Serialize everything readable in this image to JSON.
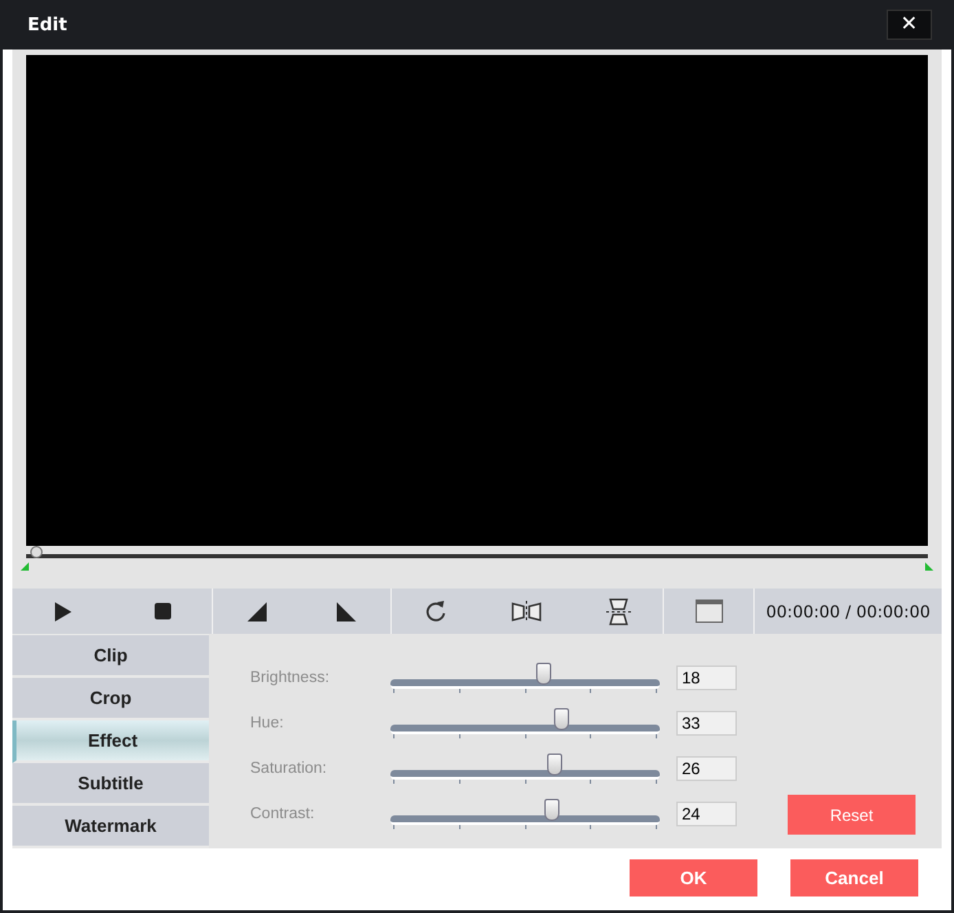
{
  "window": {
    "title": "Edit",
    "close": "✕"
  },
  "timeline": {
    "level": 0.01
  },
  "toolbar": {
    "time": "00:00:00 / 00:00:00"
  },
  "tabs": [
    {
      "label": "Clip",
      "selected": false
    },
    {
      "label": "Crop",
      "selected": false
    },
    {
      "label": "Effect",
      "selected": true
    },
    {
      "label": "Subtitle",
      "selected": false
    },
    {
      "label": "Watermark",
      "selected": false
    }
  ],
  "adjustments": [
    {
      "label": "Brightness:",
      "level": 0.57,
      "value": "18"
    },
    {
      "label": "Hue:",
      "level": 0.64,
      "value": "33"
    },
    {
      "label": "Saturation:",
      "level": 0.61,
      "value": "26"
    },
    {
      "label": "Contrast:",
      "level": 0.6,
      "value": "24"
    }
  ],
  "buttons": {
    "reset": "Reset",
    "ok": "OK",
    "cancel": "Cancel"
  }
}
